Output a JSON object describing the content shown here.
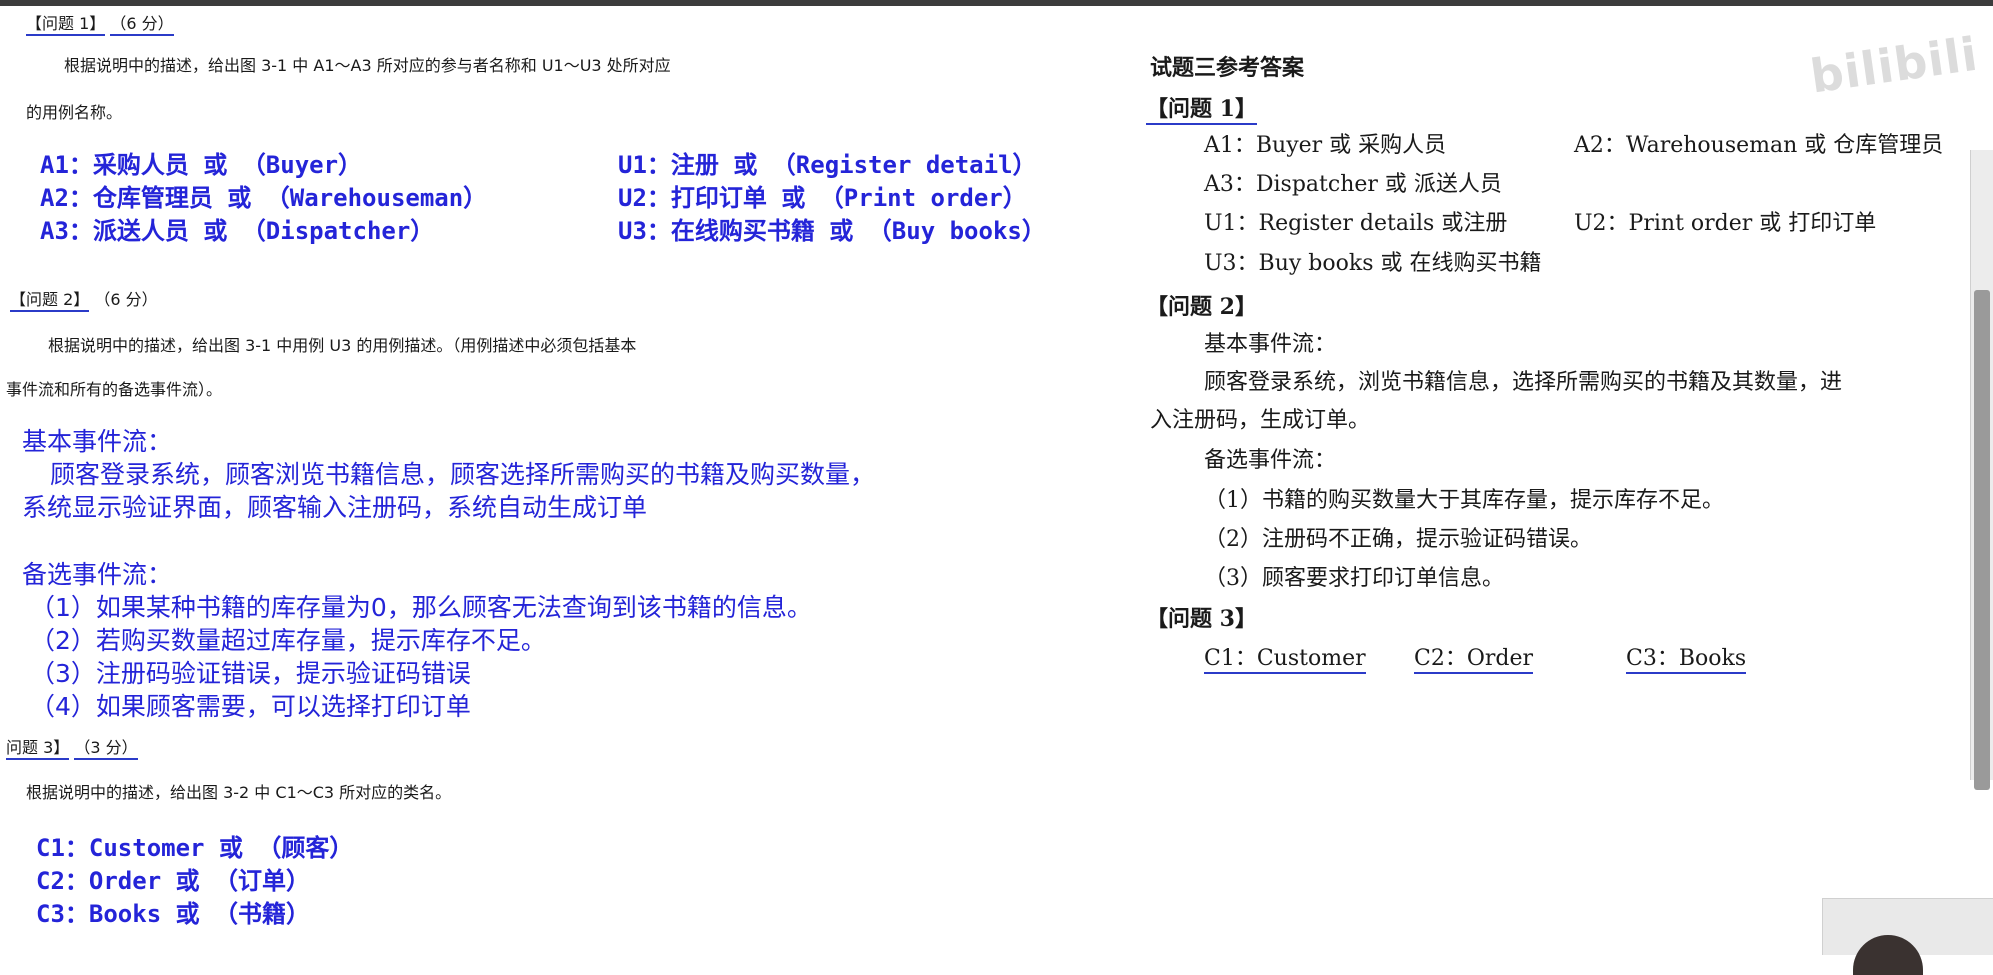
{
  "left": {
    "q1": {
      "header": "【问题 1】",
      "score": "（6 分）",
      "prompt_line1": "根据说明中的描述，给出图 3-1 中 A1～A3 所对应的参与者名称和 U1～U3 处所对应",
      "prompt_line2": "的用例名称。",
      "answers": {
        "a1": "A1：采购人员 或 （Buyer）",
        "a2": "A2：仓库管理员 或 （Warehouseman）",
        "a3": "A3：派送人员 或 （Dispatcher）",
        "u1": "U1：注册 或 （Register detail）",
        "u2": "U2：打印订单 或 （Print order）",
        "u3": "U3：在线购买书籍 或 （Buy books）"
      }
    },
    "q2": {
      "header": "【问题 2】",
      "score": "（6 分）",
      "prompt_line1": "根据说明中的描述，给出图 3-1 中用例 U3 的用例描述。（用例描述中必须包括基本",
      "prompt_line2": "事件流和所有的备选事件流）。",
      "basic_title": "基本事件流：",
      "basic_line1": "顾客登录系统，顾客浏览书籍信息，顾客选择所需购买的书籍及购买数量，",
      "basic_line2": "系统显示验证界面，顾客输入注册码，系统自动生成订单",
      "alt_title": "备选事件流：",
      "alt_items": [
        "（1）如果某种书籍的库存量为0，那么顾客无法查询到该书籍的信息。",
        "（2）若购买数量超过库存量，提示库存不足。",
        "（3）注册码验证错误，提示验证码错误",
        "（4）如果顾客需要，可以选择打印订单"
      ]
    },
    "q3": {
      "header": "问题 3】",
      "score": "（3 分）",
      "prompt": "根据说明中的描述，给出图 3-2 中 C1～C3 所对应的类名。",
      "answers": [
        "C1：Customer 或 （顾客）",
        "C2：Order 或 （订单）",
        "C3：Books 或 （书籍）"
      ]
    }
  },
  "right": {
    "title": "试题三参考答案",
    "q1": {
      "header": "【问题 1】",
      "a1": "A1：Buyer 或 采购人员",
      "a2": "A2：Warehouseman 或 仓库管理员",
      "a3": "A3：Dispatcher 或 派送人员",
      "u1": "U1：Register details 或注册",
      "u2": "U2：Print order 或 打印订单",
      "u3": "U3：Buy books 或 在线购买书籍"
    },
    "q2": {
      "header": "【问题 2】",
      "basic_title": "基本事件流：",
      "basic_line1": "顾客登录系统，浏览书籍信息，选择所需购买的书籍及其数量，进",
      "basic_line2": "入注册码，生成订单。",
      "alt_title": "备选事件流：",
      "alt_items": [
        "（1）书籍的购买数量大于其库存量，提示库存不足。",
        "（2）注册码不正确，提示验证码错误。",
        "（3）顾客要求打印订单信息。"
      ]
    },
    "q3": {
      "header": "【问题 3】",
      "c1": "C1：Customer",
      "c2": "C2：Order",
      "c3": "C3：Books"
    }
  },
  "watermark": "bilibili"
}
